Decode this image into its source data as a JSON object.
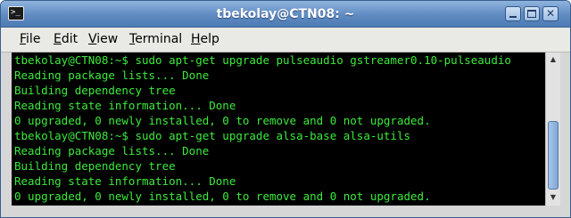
{
  "window": {
    "title": "tbekolay@CTN08: ~",
    "app_icon_glyph": ">_",
    "controls": {
      "minimize_icon": "minimize-icon",
      "maximize_icon": "maximize-icon",
      "close_icon": "close-icon",
      "close_glyph": "✕"
    },
    "accent_color": "#5f8bc2"
  },
  "menubar": {
    "items": [
      {
        "mnemonic": "F",
        "rest": "ile"
      },
      {
        "mnemonic": "E",
        "rest": "dit"
      },
      {
        "mnemonic": "V",
        "rest": "iew"
      },
      {
        "mnemonic": "T",
        "rest": "erminal"
      },
      {
        "mnemonic": "H",
        "rest": "elp"
      }
    ]
  },
  "terminal": {
    "text_color": "#3dea3d",
    "background": "#000000",
    "lines": [
      "tbekolay@CTN08:~$ sudo apt-get upgrade pulseaudio gstreamer0.10-pulseaudio",
      "Reading package lists... Done",
      "Building dependency tree",
      "Reading state information... Done",
      "0 upgraded, 0 newly installed, 0 to remove and 0 not upgraded.",
      "tbekolay@CTN08:~$ sudo apt-get upgrade alsa-base alsa-utils",
      "Reading package lists... Done",
      "Building dependency tree",
      "Reading state information... Done",
      "0 upgraded, 0 newly installed, 0 to remove and 0 not upgraded."
    ]
  },
  "scrollbar": {
    "up_glyph": "▲",
    "down_glyph": "▼",
    "position": "bottom"
  }
}
